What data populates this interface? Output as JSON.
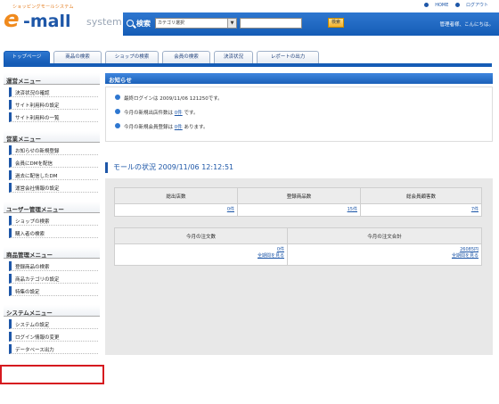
{
  "header": {
    "logo_sub": "ショッピングモールシステム",
    "logo_e": "e",
    "logo_mall": "-mall",
    "logo_system": "system",
    "top_links": {
      "home": "HOME",
      "logout": "ログアウト"
    },
    "search_label": "検索",
    "category_select": "カテゴリ選択",
    "search_button": "検索",
    "greeting": "管理者様、こんにちは。"
  },
  "tabs": [
    "トップページ",
    "商品の検索",
    "ショップの検索",
    "会員の検索",
    "決済状況",
    "レポートの出力"
  ],
  "sidebar": {
    "groups": [
      {
        "title": "運営メニュー",
        "items": [
          "決済状況の確認",
          "サイト利用料の設定",
          "サイト利用料の一覧"
        ]
      },
      {
        "title": "営業メニュー",
        "items": [
          "お知らせの新規登録",
          "会員にDMを配信",
          "過去に配信したDM",
          "運営会社情報の設定"
        ]
      },
      {
        "title": "ユーザー管理メニュー",
        "items": [
          "ショップの検索",
          "購入者の検索"
        ]
      },
      {
        "title": "商品管理メニュー",
        "items": [
          "登録商品の検索",
          "商品カテゴリの設定",
          "特集の設定"
        ]
      },
      {
        "title": "システムメニュー",
        "items": [
          "システムの設定",
          "ログイン情報の変更",
          "データベース出力"
        ]
      }
    ]
  },
  "notice": {
    "title": "お知らせ",
    "lines": [
      {
        "pre": "最終ログインは 2009/11/06 121250です。",
        "link": "",
        "post": ""
      },
      {
        "pre": "今月の新規出店件数は ",
        "link": "0件",
        "post": " です。"
      },
      {
        "pre": "今月の新規会員登録は ",
        "link": "0件",
        "post": " あります。"
      }
    ]
  },
  "status": {
    "title": "モールの状況 2009/11/06 12:12:51",
    "table1": {
      "headers": [
        "総出店数",
        "登録商品数",
        "総会員顧客数"
      ],
      "values": [
        "0件",
        "15件",
        "7件"
      ]
    },
    "table2": {
      "headers": [
        "今月の注文数",
        "今月の注文合計"
      ],
      "values": [
        "0件",
        "26085円"
      ],
      "links": [
        "全期間を見る",
        "全期間を見る"
      ]
    }
  }
}
